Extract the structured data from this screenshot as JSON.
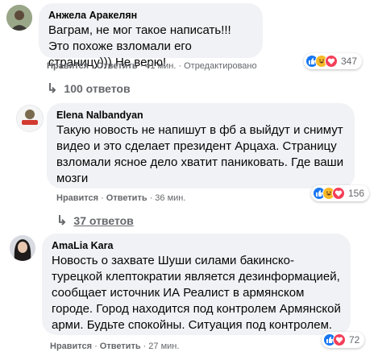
{
  "comments": [
    {
      "author": "Анжела Аракелян",
      "text": "Ваграм, не мог такое написать!!! Это похоже взломали его страницу))) Не верю!",
      "like": "Нравится",
      "reply": "Ответить",
      "time": "41 мин.",
      "edited": "Отредактировано",
      "reaction_count": "347",
      "replies": "100 ответов"
    },
    {
      "author": "Elena Nalbandyan",
      "text": "Такую новость не напишут в фб а выйдут и снимут видео и это сделает президент Арцаха. Страницу взломали ясное дело хватит паниковать. Где ваши мозги",
      "like": "Нравится",
      "reply": "Ответить",
      "time": "36 мин.",
      "reaction_count": "156",
      "replies": "37 ответов"
    },
    {
      "author": "AmaLia Kara",
      "text": "Новость о захвате Шуши силами бакинско-турецкой клептократии является дезинформацией, сообщает источник ИА Реалист в армянском городе. Город находится под контролем Армянской арми. Будьте спокойны. Ситуация под контролем.",
      "like": "Нравится",
      "reply": "Ответить",
      "time": "27 мин.",
      "reaction_count": "72"
    }
  ],
  "separator": "·",
  "reply_arrow": "↳",
  "icons": {
    "like": "like-reaction-icon",
    "haha": "haha-reaction-icon",
    "love": "love-reaction-icon"
  },
  "colors": {
    "like_blue": "#1877f2",
    "haha_yellow": "#f7b928",
    "love_red": "#f33e58",
    "meta_gray": "#65676b",
    "bubble": "#f0f2f5"
  }
}
